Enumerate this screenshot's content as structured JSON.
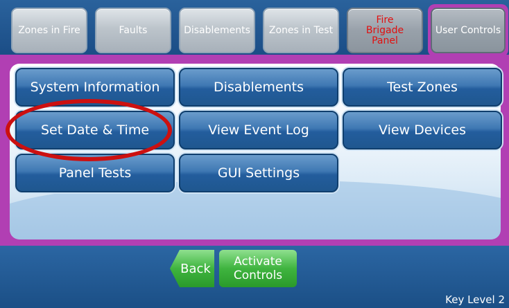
{
  "top_tabs": {
    "zones_in_fire": "Zones in Fire",
    "faults": "Faults",
    "disablements": "Disablements",
    "zones_in_test": "Zones in Test",
    "fire_brigade_panel": [
      "Fire",
      "Brigade",
      "Panel"
    ],
    "user_controls": "User Controls"
  },
  "menu": {
    "system_information": "System Information",
    "disablements": "Disablements",
    "test_zones": "Test Zones",
    "set_date_time": "Set Date & Time",
    "view_event_log": "View Event Log",
    "view_devices": "View Devices",
    "panel_tests": "Panel Tests",
    "gui_settings": "GUI Settings"
  },
  "bottom": {
    "back": "Back",
    "activate_controls": [
      "Activate",
      "Controls"
    ],
    "key_level": "Key Level 2"
  },
  "colors": {
    "accent_purple": "#b13fb3",
    "button_blue": "#235d9d",
    "action_green": "#3fb43f",
    "alarm_red": "#e01010"
  }
}
